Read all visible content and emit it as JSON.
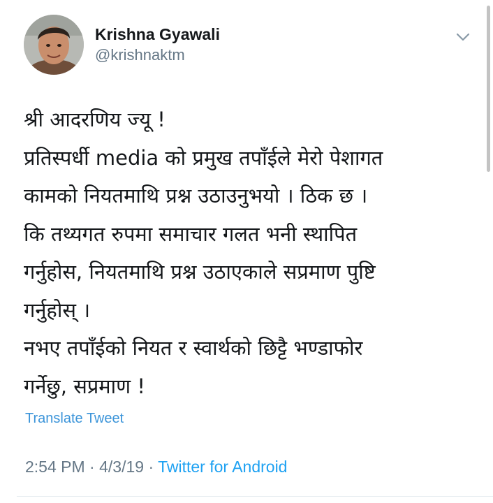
{
  "user": {
    "display_name": "Krishna Gyawali",
    "handle": "@krishnaktm"
  },
  "tweet": {
    "lines": [
      "श्री आदरणिय ज्यू !",
      "प्रतिस्पर्धी media को प्रमुख तपाँईले मेरो पेशागत",
      "कामको नियतमाथि प्रश्न उठाउनुभयो । ठिक छ ।",
      "कि तथ्यगत रुपमा समाचार गलत भनी स्थापित",
      "गर्नुहोस, नियतमाथि प्रश्न उठाएकाले सप्रमाण पुष्टि",
      "गर्नुहोस् ।",
      "नभए तपाँईको नियत र स्वार्थको छिट्टै भण्डाफोर",
      "गर्नेछु, सप्रमाण !"
    ],
    "translate_label": "Translate Tweet",
    "time": "2:54 PM",
    "date": "4/3/19",
    "separator": "·",
    "source": "Twitter for Android"
  },
  "icons": {
    "menu": "chevron-down-icon",
    "avatar": "profile-photo"
  },
  "colors": {
    "text": "#14171a",
    "secondary": "#657786",
    "link": "#1da1f2",
    "translate": "#3b94d9"
  }
}
